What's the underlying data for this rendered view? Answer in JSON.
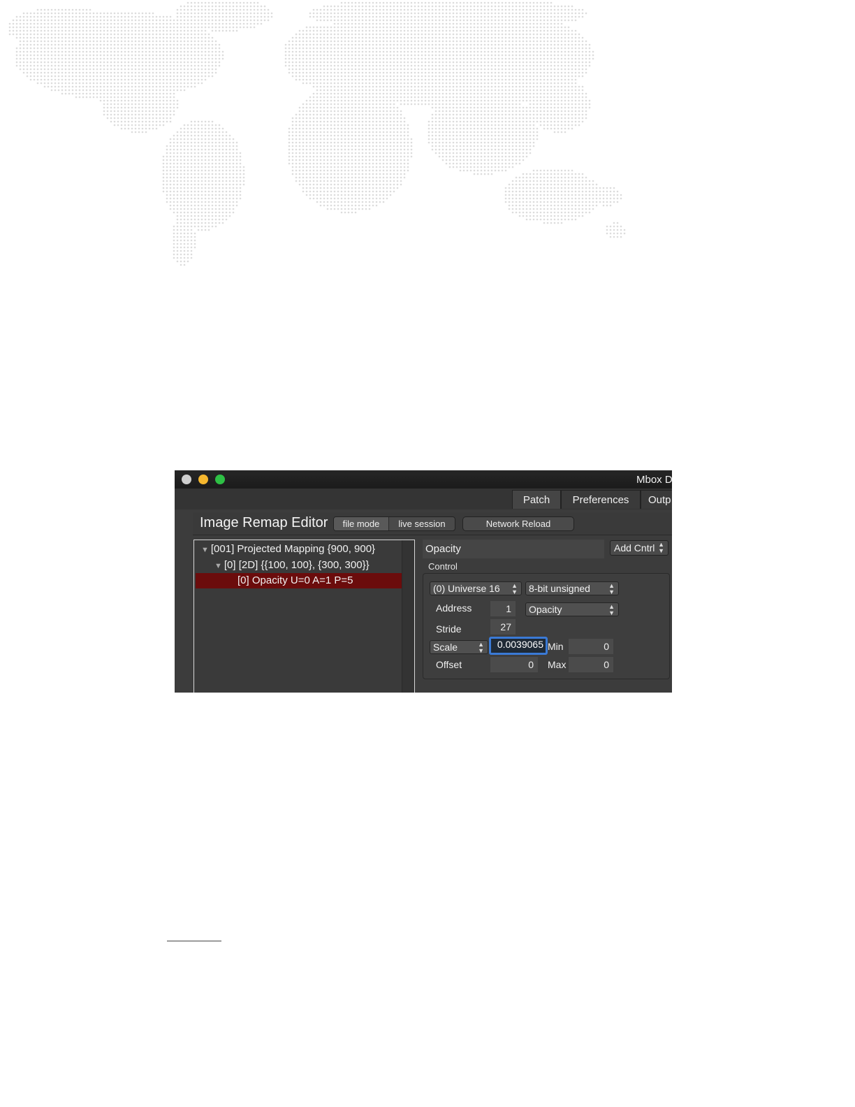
{
  "window": {
    "title": "Mbox D",
    "tabs": [
      "Patch",
      "Preferences",
      "Outp"
    ]
  },
  "editor": {
    "title": "Image Remap Editor",
    "mode_file": "file mode",
    "mode_live": "live session",
    "network_reload": "Network Reload"
  },
  "tree": {
    "rows": [
      {
        "label": "[001] Projected Mapping {900, 900}",
        "expanded": true
      },
      {
        "label": "[0]   [2D] {{100, 100}, {300, 300}}",
        "expanded": true
      },
      {
        "label": "[0] Opacity U=0 A=1 P=5",
        "selected": true
      }
    ]
  },
  "props": {
    "header": "Opacity",
    "add_control": "Add Cntrl",
    "control_label": "Control",
    "universe": "(0) Universe 16",
    "bit_depth": "8-bit unsigned",
    "address_label": "Address",
    "address": "1",
    "param": "Opacity",
    "stride_label": "Stride",
    "stride": "27",
    "scale_mode": "Scale",
    "scale": "0.0039065",
    "min_label": "Min",
    "min": "0",
    "offset_label": "Offset",
    "offset": "0",
    "max_label": "Max",
    "max": "0"
  },
  "colors": {
    "map_dots": "#dcdcdc",
    "selection": "#6b0c0c",
    "focus_ring": "#3a7ad6"
  },
  "icons": [
    "triangle-down-icon",
    "stepper-arrows-icon"
  ]
}
